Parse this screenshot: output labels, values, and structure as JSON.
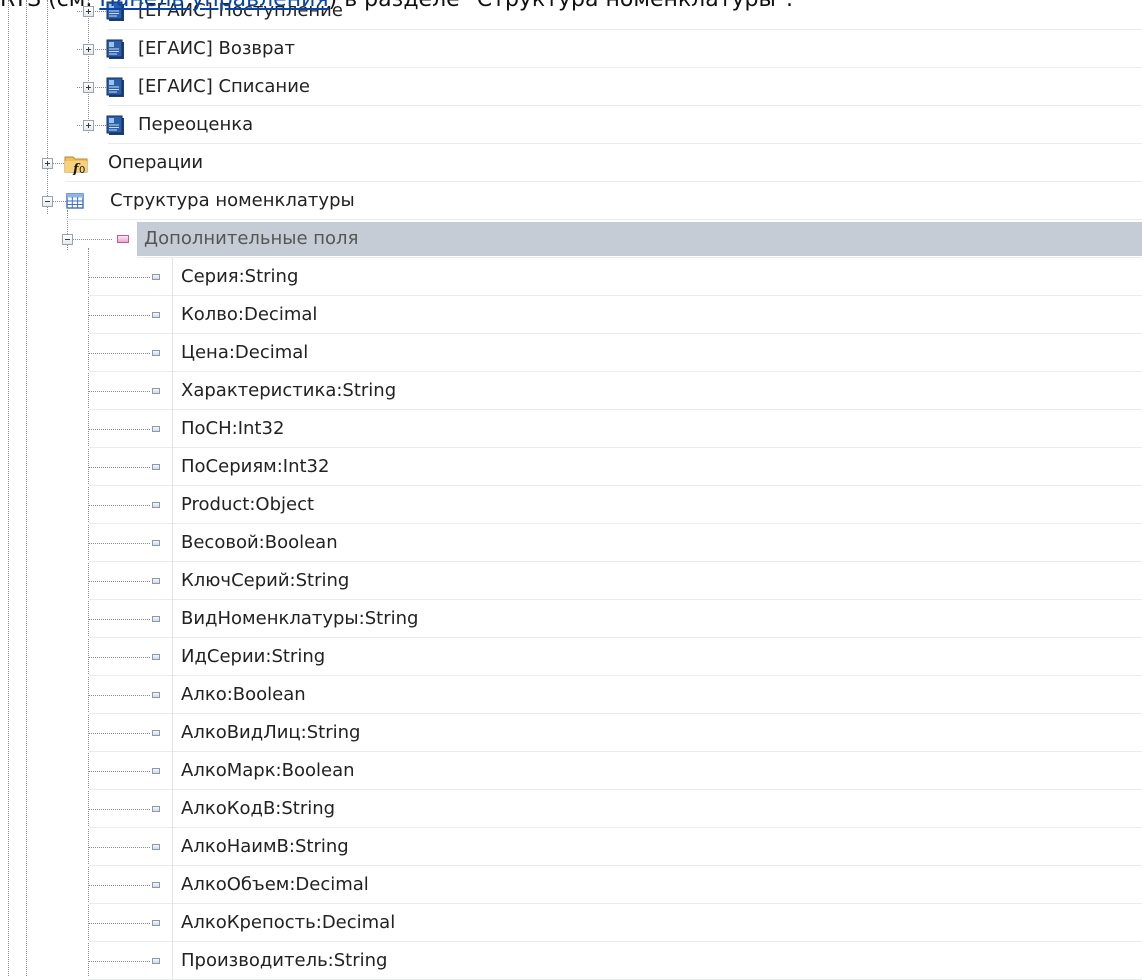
{
  "header": {
    "prefix": "RTS (см. ",
    "link": "Панель управления",
    "suffix": ") в разделе \"Структура номенклатуры\"."
  },
  "tree": {
    "documents": [
      {
        "label": "[ЕГАИС] Поступление",
        "icon": "document-blue-icon"
      },
      {
        "label": "[ЕГАИС] Возврат",
        "icon": "document-blue-icon"
      },
      {
        "label": "[ЕГАИС] Списание",
        "icon": "document-blue-icon"
      },
      {
        "label": "Переоценка",
        "icon": "document-blue-icon"
      }
    ],
    "operations": {
      "label": "Операции",
      "icon": "folder-function-icon"
    },
    "structure": {
      "label": "Структура номенклатуры",
      "icon": "table-icon"
    },
    "extra_fields": {
      "label": "Дополнительные поля",
      "icon": "field-group-icon"
    },
    "fields": [
      "Серия:String",
      "Колво:Decimal",
      "Цена:Decimal",
      "Характеристика:String",
      "ПоСН:Int32",
      "ПоСериям:Int32",
      "Product:Object",
      "Весовой:Boolean",
      "КлючСерий:String",
      "ВидНоменклатуры:String",
      "ИдСерии:String",
      "Алко:Boolean",
      "АлкоВидЛиц:String",
      "АлкоМарк:Boolean",
      "АлкоКодВ:String",
      "АлкоНаимВ:String",
      "АлкоОбъем:Decimal",
      "АлкоКрепость:Decimal",
      "Производитель:String"
    ]
  }
}
